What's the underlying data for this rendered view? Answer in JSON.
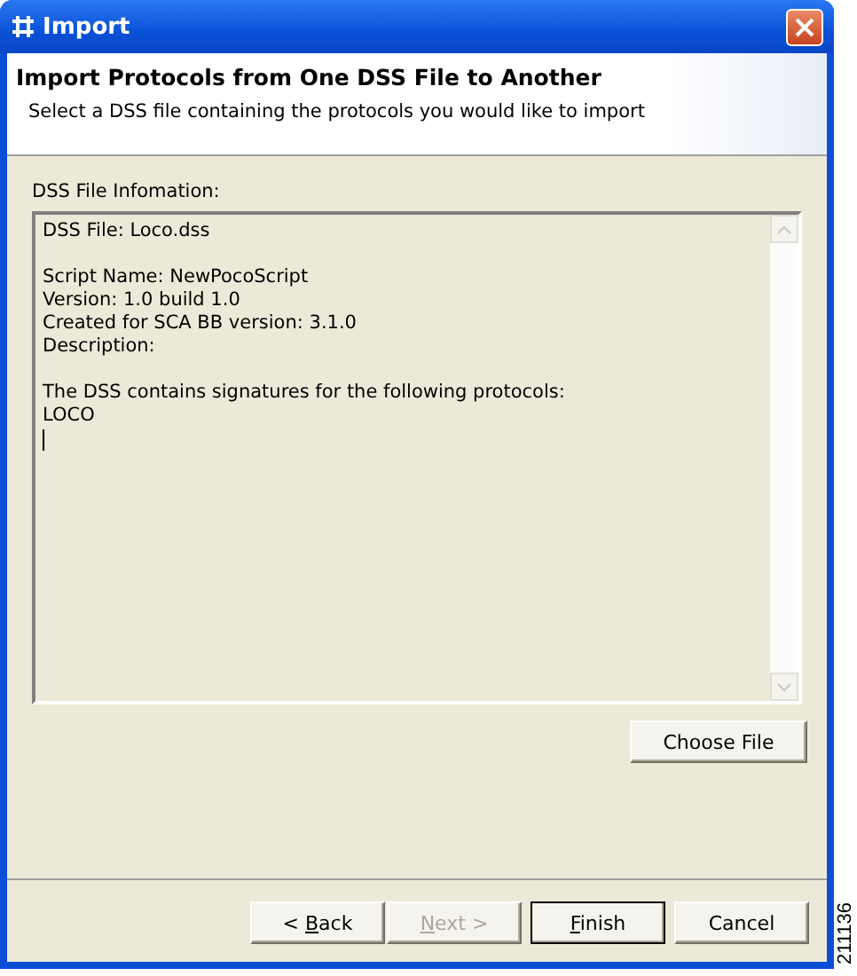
{
  "window": {
    "title": "Import"
  },
  "header": {
    "title": "Import Protocols from One DSS File to Another",
    "subtitle": "Select a DSS file containing the protocols you would like to import"
  },
  "info": {
    "label": "DSS File Infomation:",
    "paragraphs": [
      [
        "DSS File: Loco.dss"
      ],
      [
        "Script Name: NewPocoScript",
        "Version: 1.0 build 1.0",
        "Created for SCA BB version: 3.1.0",
        "Description:"
      ],
      [
        "The DSS contains signatures for the following protocols:",
        "LOCO"
      ]
    ],
    "caret": true
  },
  "choose_button": {
    "label": "Choose File"
  },
  "buttons": [
    {
      "prefix": "< ",
      "key": "B",
      "suffix": "ack",
      "disabled": false,
      "default": false
    },
    {
      "key": "N",
      "suffix": "ext >",
      "disabled": true,
      "default": false
    },
    {
      "key": "F",
      "suffix": "inish",
      "disabled": false,
      "default": true
    },
    {
      "prefix": "Cancel",
      "disabled": false,
      "default": false
    }
  ],
  "figure_id": "211136"
}
